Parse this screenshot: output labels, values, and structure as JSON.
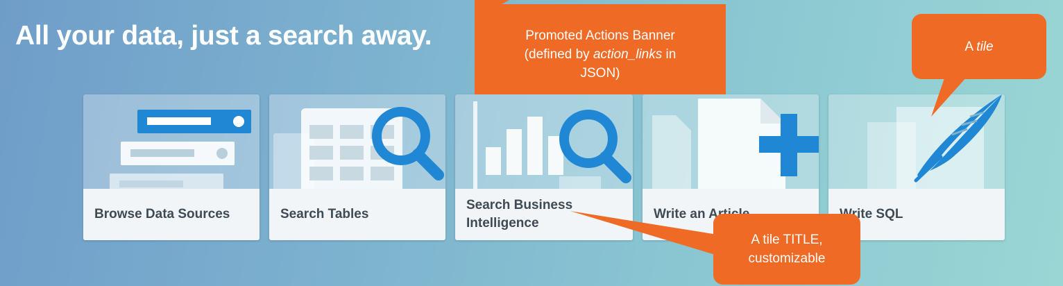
{
  "headline": "All your data, just a search away.",
  "colors": {
    "accent": "#1f87d4",
    "callout": "#ef6a25",
    "tile_title_bg": "#f1f5f7",
    "title_text": "#3f4a54"
  },
  "tiles": [
    {
      "title": "Browse Data Sources",
      "icon": "server-stack-icon"
    },
    {
      "title": "Search Tables",
      "icon": "table-search-icon"
    },
    {
      "title": "Search Business Intelligence",
      "icon": "chart-search-icon"
    },
    {
      "title": "Write an Article",
      "icon": "document-plus-icon"
    },
    {
      "title": "Write SQL",
      "icon": "quill-icon"
    }
  ],
  "callouts": {
    "banner": {
      "line1": "Promoted Actions Banner",
      "line2_pre": "(defined by ",
      "line2_em": "action_links",
      "line2_post": " in",
      "line3": "JSON)"
    },
    "tile": {
      "pre": "A ",
      "em": "tile"
    },
    "title": {
      "line1": "A tile TITLE,",
      "line2": "customizable"
    }
  }
}
